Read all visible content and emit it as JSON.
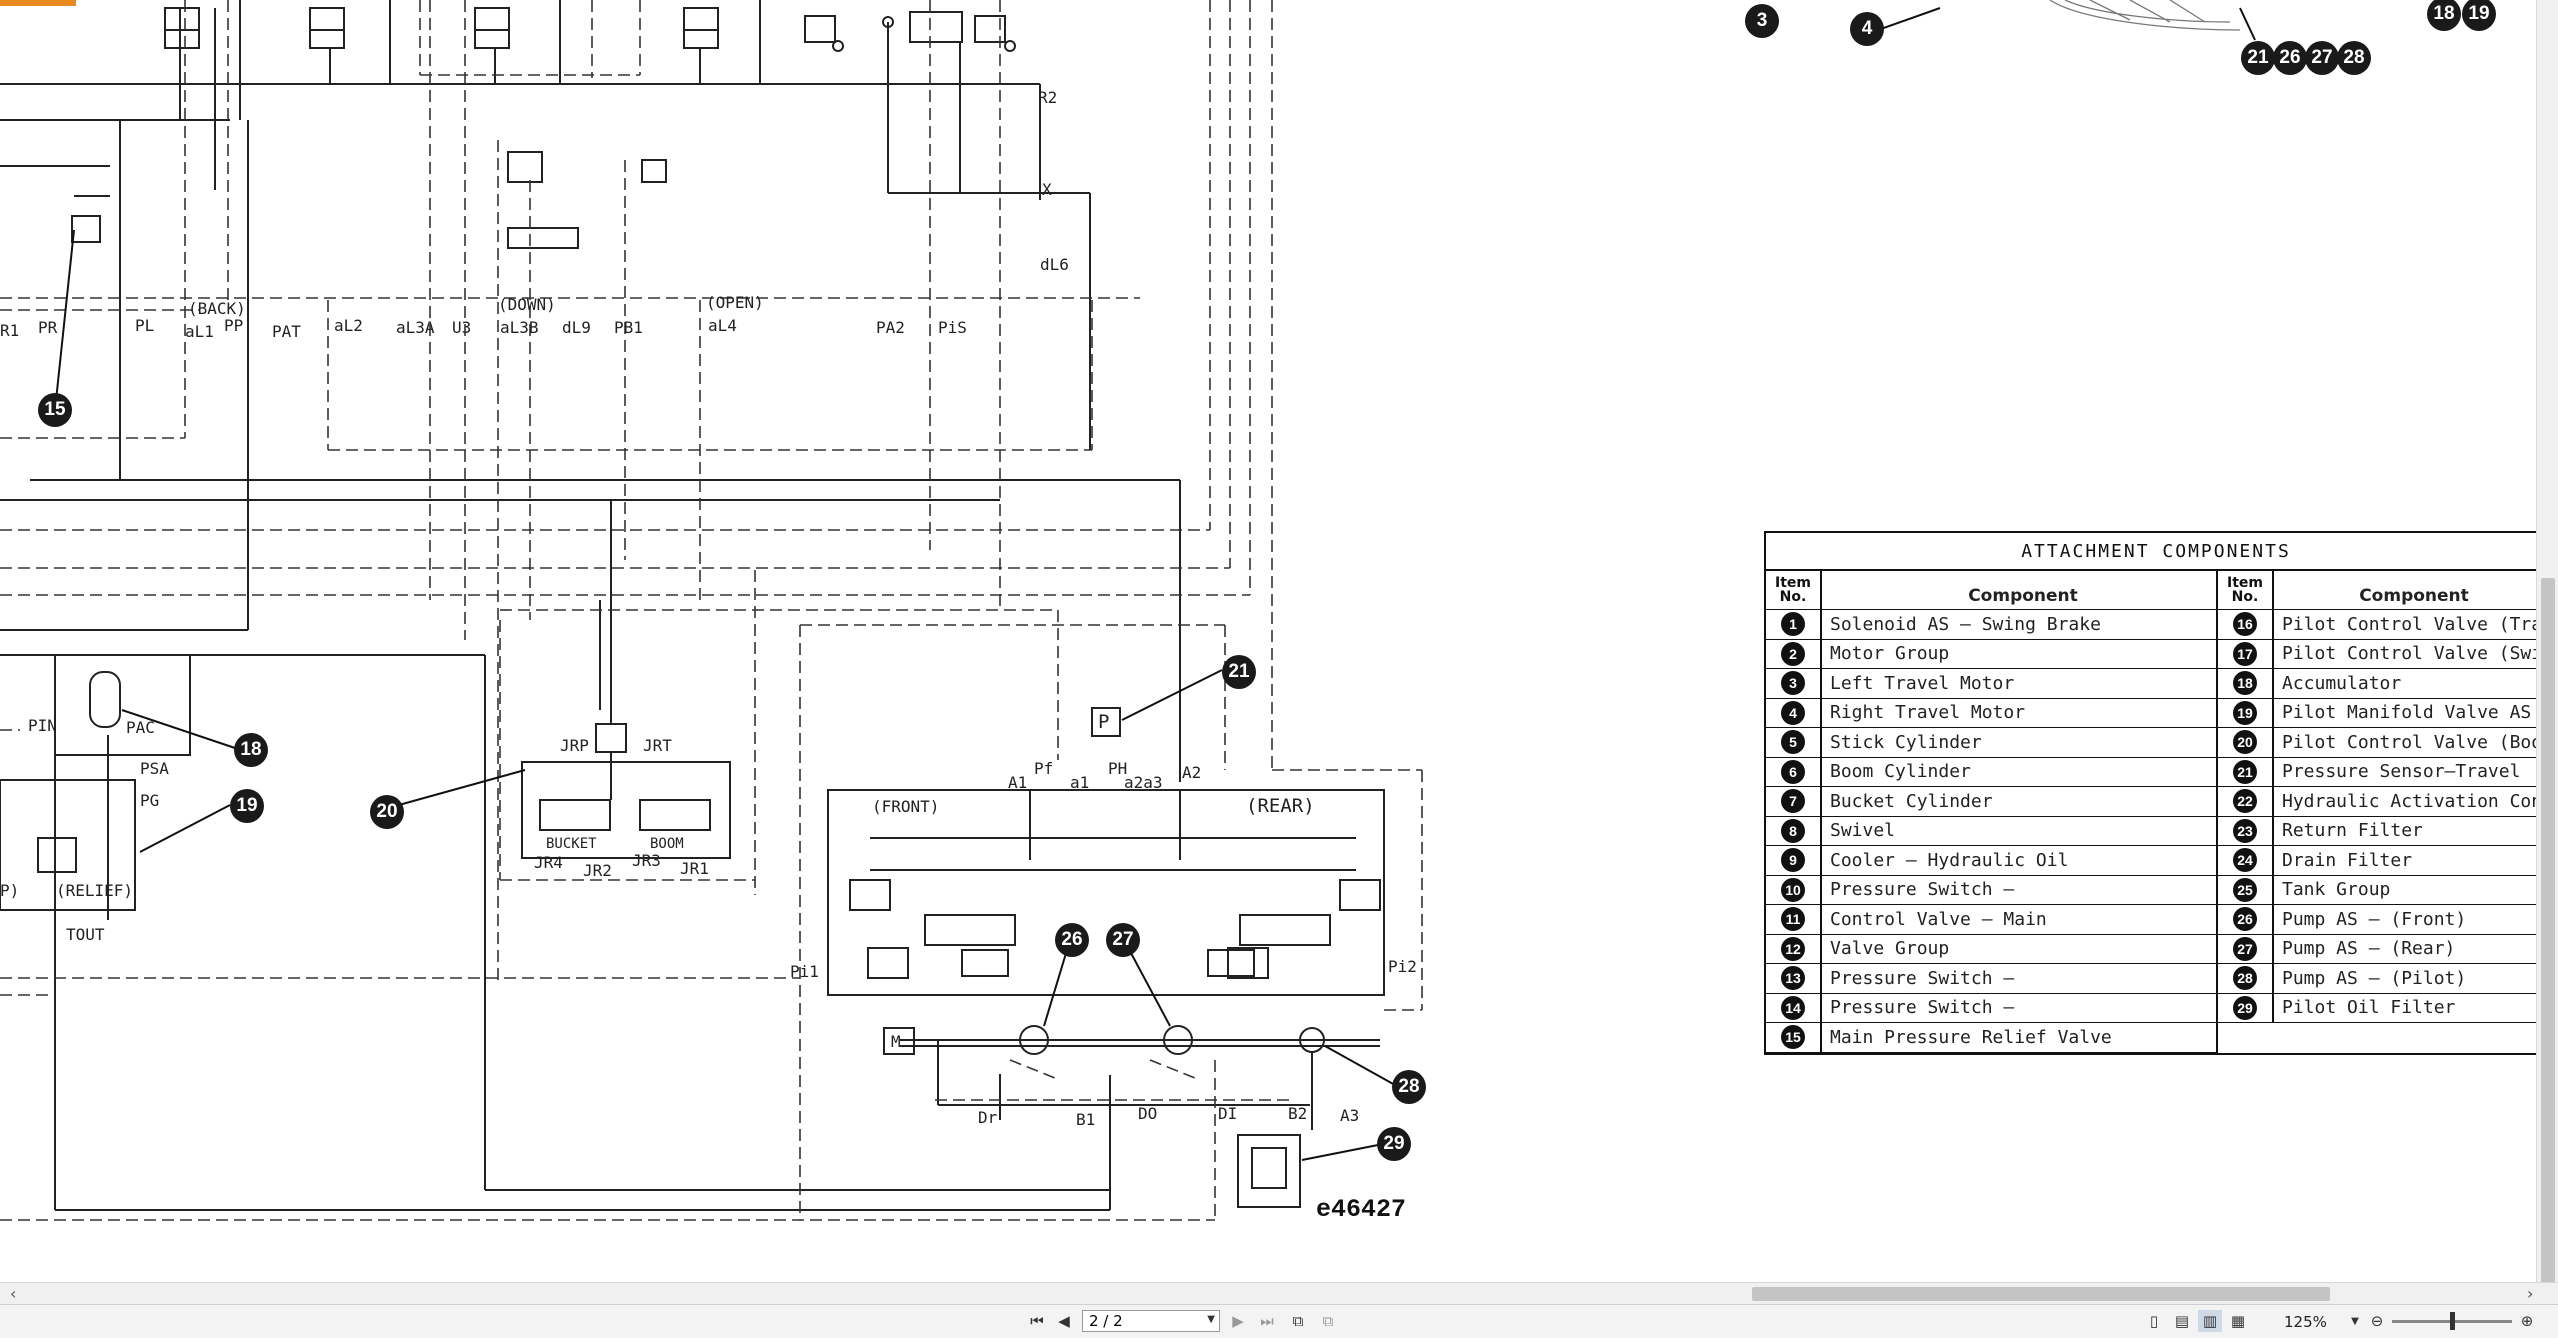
{
  "viewer": {
    "page_indicator": "2 / 2",
    "zoom": "125%",
    "accent_color": "#e98a1f"
  },
  "schematic": {
    "drawing_number": "e46427",
    "callouts": [
      "3",
      "4",
      "18",
      "19",
      "21",
      "26",
      "27",
      "28",
      "15",
      "18",
      "19",
      "20",
      "21",
      "26",
      "27",
      "28",
      "29"
    ],
    "labels": {
      "r2": "R2",
      "x": "X",
      "dl6": "dL6",
      "back": "(BACK)",
      "down": "(DOWN)",
      "open": "(OPEN)",
      "r1": "R1",
      "pr": "PR",
      "pl": "PL",
      "al1": "aL1",
      "pp": "PP",
      "pat": "PAT",
      "al2": "aL2",
      "al3a": "aL3A",
      "u3": "U3",
      "al3b": "aL3B",
      "dl9": "dL9",
      "pb1": "PB1",
      "al4": "aL4",
      "pa2": "PA2",
      "pis": "PiS",
      "pin": "PIN",
      "pac": "PAC",
      "psa": "PSA",
      "pg": "PG",
      "p": "P)",
      "relief": "(RELIEF)",
      "tout": "TOUT",
      "jrp": "JRP",
      "jrt": "JRT",
      "bucket": "BUCKET",
      "boom": "BOOM",
      "jr4": "JR4",
      "jr2": "JR2",
      "jr3": "JR3",
      "jr1": "JR1",
      "a1": "A1",
      "pf": "Pf",
      "a1l": "a1",
      "ph": "PH",
      "a2a3": "a2a3",
      "a2": "A2",
      "front": "(FRONT)",
      "rear": "(REAR)",
      "pi1": "Pi1",
      "pi2": "Pi2",
      "m": "M",
      "pbox": "P",
      "dr": "Dr",
      "b1": "B1",
      "do": "DO",
      "di": "DI",
      "b2": "B2",
      "a3": "A3"
    }
  },
  "table": {
    "title": "ATTACHMENT COMPONENTS",
    "header_item": "Item No.",
    "header_item_l1": "Item",
    "header_item_l2": "No.",
    "header_component": "Component",
    "left": [
      {
        "n": "1",
        "c": "Solenoid AS – Swing Brake"
      },
      {
        "n": "2",
        "c": "Motor Group"
      },
      {
        "n": "3",
        "c": "Left Travel Motor"
      },
      {
        "n": "4",
        "c": "Right Travel Motor"
      },
      {
        "n": "5",
        "c": "Stick Cylinder"
      },
      {
        "n": "6",
        "c": "Boom Cylinder"
      },
      {
        "n": "7",
        "c": "Bucket Cylinder"
      },
      {
        "n": "8",
        "c": "Swivel"
      },
      {
        "n": "9",
        "c": "Cooler – Hydraulic Oil"
      },
      {
        "n": "10",
        "c": "Pressure Switch –"
      },
      {
        "n": "11",
        "c": "Control Valve – Main"
      },
      {
        "n": "12",
        "c": "Valve Group"
      },
      {
        "n": "13",
        "c": "Pressure Switch –"
      },
      {
        "n": "14",
        "c": "Pressure Switch –"
      },
      {
        "n": "15",
        "c": "Main Pressure Relief Valve"
      }
    ],
    "right": [
      {
        "n": "16",
        "c": "Pilot Control Valve (Tra"
      },
      {
        "n": "17",
        "c": "Pilot Control Valve (Swi"
      },
      {
        "n": "18",
        "c": "Accumulator"
      },
      {
        "n": "19",
        "c": "Pilot Manifold Valve AS"
      },
      {
        "n": "20",
        "c": "Pilot Control Valve (Boo"
      },
      {
        "n": "21",
        "c": "Pressure Sensor–Travel"
      },
      {
        "n": "22",
        "c": "Hydraulic Activation Con"
      },
      {
        "n": "23",
        "c": "Return Filter"
      },
      {
        "n": "24",
        "c": "Drain Filter"
      },
      {
        "n": "25",
        "c": "Tank Group"
      },
      {
        "n": "26",
        "c": "Pump AS – (Front)"
      },
      {
        "n": "27",
        "c": "Pump AS – (Rear)"
      },
      {
        "n": "28",
        "c": "Pump AS – (Pilot)"
      },
      {
        "n": "29",
        "c": "Pilot Oil Filter"
      }
    ]
  }
}
